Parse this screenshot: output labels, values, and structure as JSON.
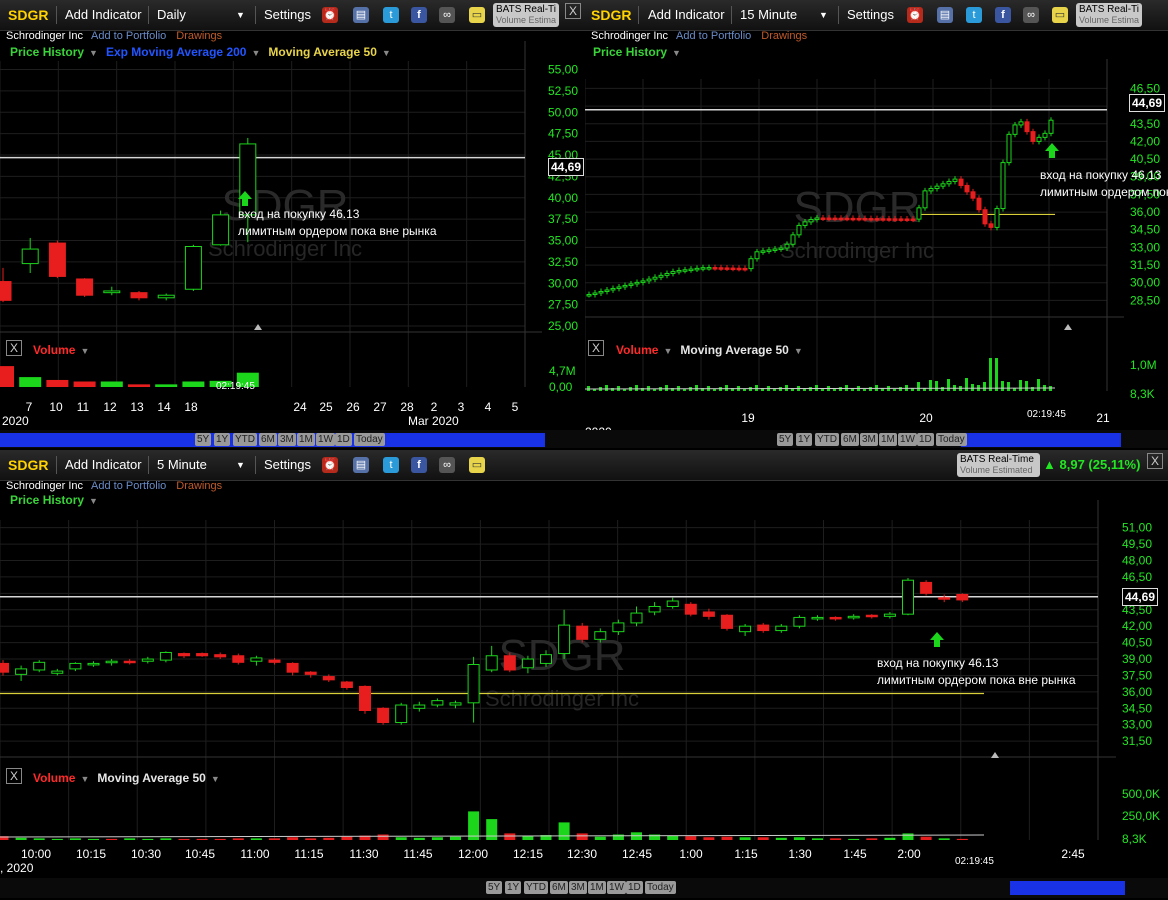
{
  "toolbar": {
    "symbol": "SDGR",
    "add_indicator": "Add Indicator",
    "settings": "Settings",
    "bats_title": "BATS Real-Time",
    "bats_sub": "Volume Estimated",
    "bats_title_short": "BATS Real-Ti",
    "bats_sub_short": "Volume Estima",
    "close": "X"
  },
  "sub_header": {
    "company": "Schrodinger Inc",
    "add_to_portfolio": "Add to Portfolio",
    "drawings": "Drawings"
  },
  "watermark": {
    "symbol": "SDGR",
    "company": "Schrodinger Inc"
  },
  "legends": {
    "price_history": "Price History",
    "ema200": "Exp Moving Average 200",
    "ma50": "Moving Average 50",
    "volume": "Volume"
  },
  "annotation": {
    "line1": "вход на покупку 46.13",
    "line2": "лимитным ордером пока вне рынка"
  },
  "ranges": [
    "5Y",
    "1Y",
    "YTD",
    "6M",
    "3M",
    "1M",
    "1W",
    "1D",
    "Today"
  ],
  "price_marker": "44,69",
  "change": "8,97 (25,11%)",
  "time_stamp": "02:19:45",
  "colors": {
    "up": "#1bd61b",
    "down": "#e81e1e",
    "hline": "#d6d6d6",
    "ma": "#d8cf3a",
    "axis_text": "#22e622",
    "nav_blue": "#1a32e6"
  },
  "chart_data": [
    {
      "type": "candlestick",
      "interval": "Daily",
      "x_ticks": [
        "7",
        "10",
        "11",
        "12",
        "13",
        "14",
        "18",
        "24",
        "25",
        "26",
        "27",
        "28",
        "2",
        "3",
        "4",
        "5"
      ],
      "x_sub_labels": [
        "2020",
        "Mar 2020"
      ],
      "y_ticks": [
        "55,00",
        "52,50",
        "50,00",
        "47,50",
        "45,00",
        "42,50",
        "40,00",
        "37,50",
        "35,00",
        "32,50",
        "30,00",
        "27,50",
        "25,00"
      ],
      "ylim": [
        25,
        56
      ],
      "candles": [
        {
          "o": 30.2,
          "c": 28.0,
          "h": 31.8,
          "l": 27.8
        },
        {
          "o": 32.3,
          "c": 34.0,
          "h": 35.3,
          "l": 31.2
        },
        {
          "o": 34.7,
          "c": 30.8,
          "h": 35.0,
          "l": 30.6
        },
        {
          "o": 30.5,
          "c": 28.6,
          "h": 30.6,
          "l": 28.4
        },
        {
          "o": 28.9,
          "c": 29.1,
          "h": 29.6,
          "l": 28.6
        },
        {
          "o": 28.9,
          "c": 28.3,
          "h": 29.1,
          "l": 28.0
        },
        {
          "o": 28.3,
          "c": 28.6,
          "h": 28.8,
          "l": 28.0
        },
        {
          "o": 29.3,
          "c": 34.3,
          "h": 34.5,
          "l": 29.1
        },
        {
          "o": 34.5,
          "c": 38.0,
          "h": 38.5,
          "l": 34.4
        },
        {
          "o": 38.0,
          "c": 46.3,
          "h": 47.0,
          "l": 34.8
        }
      ],
      "volume_ticks": [
        "4,7M",
        "0,00"
      ],
      "volume": [
        {
          "v": 0.95,
          "up": false
        },
        {
          "v": 0.45,
          "up": true
        },
        {
          "v": 0.32,
          "up": false
        },
        {
          "v": 0.25,
          "up": false
        },
        {
          "v": 0.25,
          "up": true
        },
        {
          "v": 0.12,
          "up": false
        },
        {
          "v": 0.12,
          "up": true
        },
        {
          "v": 0.25,
          "up": true
        },
        {
          "v": 0.28,
          "up": true
        },
        {
          "v": 0.65,
          "up": true
        }
      ],
      "hline": 44.69
    },
    {
      "type": "candlestick",
      "interval": "15 Minute",
      "x_ticks": [
        "19",
        "20",
        "21"
      ],
      "x_sub_labels": [
        "2020"
      ],
      "y_ticks": [
        "46,50",
        "45,00",
        "43,50",
        "42,00",
        "40,50",
        "39,00",
        "37,50",
        "36,00",
        "34,50",
        "33,00",
        "31,50",
        "30,00",
        "28,50"
      ],
      "ylim": [
        27.6,
        47.3
      ],
      "hline": 44.69,
      "ma_value": 35.8,
      "volume_ticks": [
        "1,0M",
        "8,3K"
      ]
    },
    {
      "type": "candlestick",
      "interval": "5 Minute",
      "x_ticks": [
        "10:00",
        "10:15",
        "10:30",
        "10:45",
        "11:00",
        "11:15",
        "11:30",
        "11:45",
        "12:00",
        "12:15",
        "12:30",
        "12:45",
        "1:00",
        "1:15",
        "1:30",
        "1:45",
        "2:00",
        "2:45"
      ],
      "x_sub_labels": [
        ", 2020"
      ],
      "y_ticks": [
        "51,00",
        "49,50",
        "48,00",
        "46,50",
        "45,00",
        "43,50",
        "42,00",
        "40,50",
        "39,00",
        "37,50",
        "36,00",
        "34,50",
        "33,00",
        "31,50"
      ],
      "ylim": [
        30.6,
        51.7
      ],
      "hline": 44.69,
      "ma_value": 35.85,
      "volume_ticks": [
        "500,0K",
        "250,0K",
        "8,3K"
      ],
      "candles": [
        {
          "o": 38.6,
          "c": 37.8,
          "h": 38.9,
          "l": 37.5
        },
        {
          "o": 37.6,
          "c": 38.1,
          "h": 38.4,
          "l": 37.0
        },
        {
          "o": 38.0,
          "c": 38.7,
          "h": 38.9,
          "l": 37.8
        },
        {
          "o": 37.7,
          "c": 37.9,
          "h": 38.1,
          "l": 37.5
        },
        {
          "o": 38.1,
          "c": 38.6,
          "h": 38.7,
          "l": 37.9
        },
        {
          "o": 38.5,
          "c": 38.6,
          "h": 38.8,
          "l": 38.3
        },
        {
          "o": 38.7,
          "c": 38.8,
          "h": 39.0,
          "l": 38.4
        },
        {
          "o": 38.8,
          "c": 38.7,
          "h": 39.0,
          "l": 38.5
        },
        {
          "o": 38.8,
          "c": 39.0,
          "h": 39.2,
          "l": 38.6
        },
        {
          "o": 38.9,
          "c": 39.6,
          "h": 39.7,
          "l": 38.7
        },
        {
          "o": 39.5,
          "c": 39.3,
          "h": 39.6,
          "l": 39.1
        },
        {
          "o": 39.5,
          "c": 39.3,
          "h": 39.6,
          "l": 39.2
        },
        {
          "o": 39.4,
          "c": 39.2,
          "h": 39.6,
          "l": 39.0
        },
        {
          "o": 39.3,
          "c": 38.7,
          "h": 39.5,
          "l": 38.5
        },
        {
          "o": 38.8,
          "c": 39.1,
          "h": 39.3,
          "l": 38.4
        },
        {
          "o": 38.9,
          "c": 38.7,
          "h": 39.1,
          "l": 38.5
        },
        {
          "o": 38.6,
          "c": 37.8,
          "h": 38.7,
          "l": 37.5
        },
        {
          "o": 37.8,
          "c": 37.6,
          "h": 37.9,
          "l": 37.3
        },
        {
          "o": 37.4,
          "c": 37.1,
          "h": 37.6,
          "l": 36.9
        },
        {
          "o": 36.9,
          "c": 36.4,
          "h": 37.0,
          "l": 36.2
        },
        {
          "o": 36.5,
          "c": 34.3,
          "h": 36.6,
          "l": 34.0
        },
        {
          "o": 34.5,
          "c": 33.2,
          "h": 34.6,
          "l": 33.0
        },
        {
          "o": 33.2,
          "c": 34.8,
          "h": 35.0,
          "l": 33.0
        },
        {
          "o": 34.5,
          "c": 34.8,
          "h": 35.1,
          "l": 34.2
        },
        {
          "o": 34.8,
          "c": 35.2,
          "h": 35.4,
          "l": 34.6
        },
        {
          "o": 34.8,
          "c": 35.0,
          "h": 35.2,
          "l": 34.5
        },
        {
          "o": 35.0,
          "c": 38.5,
          "h": 39.2,
          "l": 33.2
        },
        {
          "o": 38.0,
          "c": 39.3,
          "h": 40.2,
          "l": 37.8
        },
        {
          "o": 39.3,
          "c": 38.0,
          "h": 39.6,
          "l": 37.8
        },
        {
          "o": 38.2,
          "c": 39.0,
          "h": 39.3,
          "l": 37.7
        },
        {
          "o": 38.6,
          "c": 39.4,
          "h": 39.8,
          "l": 38.3
        },
        {
          "o": 39.5,
          "c": 42.1,
          "h": 43.5,
          "l": 39.0
        },
        {
          "o": 42.0,
          "c": 40.8,
          "h": 42.3,
          "l": 40.5
        },
        {
          "o": 40.8,
          "c": 41.5,
          "h": 41.8,
          "l": 40.5
        },
        {
          "o": 41.5,
          "c": 42.3,
          "h": 42.6,
          "l": 41.2
        },
        {
          "o": 42.3,
          "c": 43.2,
          "h": 43.8,
          "l": 42.0
        },
        {
          "o": 43.3,
          "c": 43.8,
          "h": 44.2,
          "l": 43.0
        },
        {
          "o": 43.8,
          "c": 44.3,
          "h": 44.6,
          "l": 43.6
        },
        {
          "o": 44.0,
          "c": 43.1,
          "h": 44.2,
          "l": 42.9
        },
        {
          "o": 43.3,
          "c": 42.9,
          "h": 43.6,
          "l": 42.6
        },
        {
          "o": 43.0,
          "c": 41.8,
          "h": 43.1,
          "l": 41.6
        },
        {
          "o": 41.5,
          "c": 42.0,
          "h": 42.2,
          "l": 41.1
        },
        {
          "o": 42.1,
          "c": 41.6,
          "h": 42.3,
          "l": 41.4
        },
        {
          "o": 41.6,
          "c": 42.0,
          "h": 42.2,
          "l": 41.4
        },
        {
          "o": 42.0,
          "c": 42.8,
          "h": 43.0,
          "l": 41.8
        },
        {
          "o": 42.7,
          "c": 42.8,
          "h": 43.0,
          "l": 42.5
        },
        {
          "o": 42.8,
          "c": 42.7,
          "h": 42.9,
          "l": 42.5
        },
        {
          "o": 42.8,
          "c": 42.9,
          "h": 43.1,
          "l": 42.6
        },
        {
          "o": 43.0,
          "c": 42.9,
          "h": 43.1,
          "l": 42.7
        },
        {
          "o": 42.9,
          "c": 43.1,
          "h": 43.3,
          "l": 42.7
        },
        {
          "o": 43.1,
          "c": 46.2,
          "h": 46.4,
          "l": 43.0
        },
        {
          "o": 46.0,
          "c": 45.0,
          "h": 46.2,
          "l": 44.8
        },
        {
          "o": 44.6,
          "c": 44.5,
          "h": 44.9,
          "l": 44.2
        },
        {
          "o": 44.9,
          "c": 44.4,
          "h": 45.0,
          "l": 44.2
        }
      ],
      "volume": [
        {
          "v": 0.07,
          "up": false
        },
        {
          "v": 0.04,
          "up": true
        },
        {
          "v": 0.03,
          "up": true
        },
        {
          "v": 0.02,
          "up": true
        },
        {
          "v": 0.03,
          "up": true
        },
        {
          "v": 0.02,
          "up": true
        },
        {
          "v": 0.02,
          "up": false
        },
        {
          "v": 0.03,
          "up": true
        },
        {
          "v": 0.02,
          "up": true
        },
        {
          "v": 0.03,
          "up": true
        },
        {
          "v": 0.02,
          "up": false
        },
        {
          "v": 0.02,
          "up": false
        },
        {
          "v": 0.02,
          "up": false
        },
        {
          "v": 0.03,
          "up": false
        },
        {
          "v": 0.03,
          "up": true
        },
        {
          "v": 0.03,
          "up": false
        },
        {
          "v": 0.05,
          "up": false
        },
        {
          "v": 0.03,
          "up": false
        },
        {
          "v": 0.04,
          "up": false
        },
        {
          "v": 0.06,
          "up": false
        },
        {
          "v": 0.08,
          "up": false
        },
        {
          "v": 0.1,
          "up": false
        },
        {
          "v": 0.05,
          "up": true
        },
        {
          "v": 0.04,
          "up": true
        },
        {
          "v": 0.05,
          "up": true
        },
        {
          "v": 0.06,
          "up": true
        },
        {
          "v": 0.52,
          "up": true
        },
        {
          "v": 0.38,
          "up": true
        },
        {
          "v": 0.12,
          "up": false
        },
        {
          "v": 0.08,
          "up": true
        },
        {
          "v": 0.09,
          "up": true
        },
        {
          "v": 0.32,
          "up": true
        },
        {
          "v": 0.12,
          "up": false
        },
        {
          "v": 0.06,
          "up": true
        },
        {
          "v": 0.1,
          "up": true
        },
        {
          "v": 0.14,
          "up": true
        },
        {
          "v": 0.1,
          "up": true
        },
        {
          "v": 0.08,
          "up": true
        },
        {
          "v": 0.07,
          "up": false
        },
        {
          "v": 0.05,
          "up": false
        },
        {
          "v": 0.06,
          "up": false
        },
        {
          "v": 0.05,
          "up": true
        },
        {
          "v": 0.05,
          "up": false
        },
        {
          "v": 0.04,
          "up": true
        },
        {
          "v": 0.05,
          "up": true
        },
        {
          "v": 0.03,
          "up": true
        },
        {
          "v": 0.03,
          "up": false
        },
        {
          "v": 0.02,
          "up": true
        },
        {
          "v": 0.03,
          "up": false
        },
        {
          "v": 0.04,
          "up": true
        },
        {
          "v": 0.12,
          "up": true
        },
        {
          "v": 0.06,
          "up": false
        },
        {
          "v": 0.03,
          "up": true
        },
        {
          "v": 0.02,
          "up": false
        }
      ]
    }
  ]
}
